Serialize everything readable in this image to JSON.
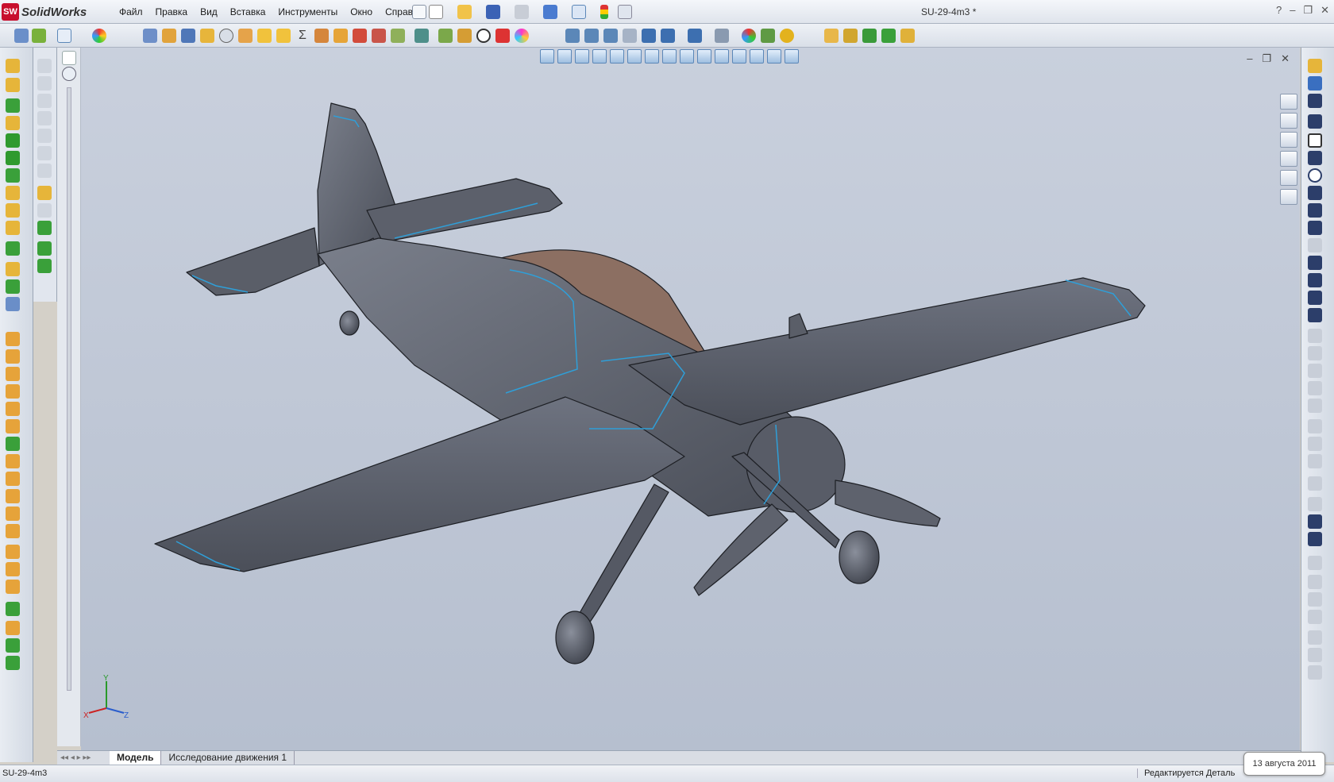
{
  "app": {
    "name": "SolidWorks",
    "logo_text": "SW"
  },
  "menu": [
    "Файл",
    "Правка",
    "Вид",
    "Вставка",
    "Инструменты",
    "Окно",
    "Справка"
  ],
  "document": {
    "title": "SU-29-4m3 *",
    "name": "SU-29-4m3"
  },
  "window_controls": {
    "help": "?",
    "minimize": "–",
    "restore": "❐",
    "close": "✕"
  },
  "viewport_controls": {
    "minimize": "–",
    "restore": "❐",
    "close": "✕"
  },
  "tabs": [
    {
      "label": "Модель",
      "active": true
    },
    {
      "label": "Исследование движения 1",
      "active": false
    }
  ],
  "status": {
    "left": "SU-29-4m3",
    "right": "Редактируется Деталь"
  },
  "tooltip": {
    "date": "13 августа 2011"
  },
  "triad": {
    "x": "X",
    "y": "Y",
    "z": "Z"
  },
  "colors": {
    "model_gray": "#5f6470",
    "canopy": "#8c6f62",
    "edge_blue": "#2f9fd8",
    "viewport_bg": "#bfc6d4"
  }
}
